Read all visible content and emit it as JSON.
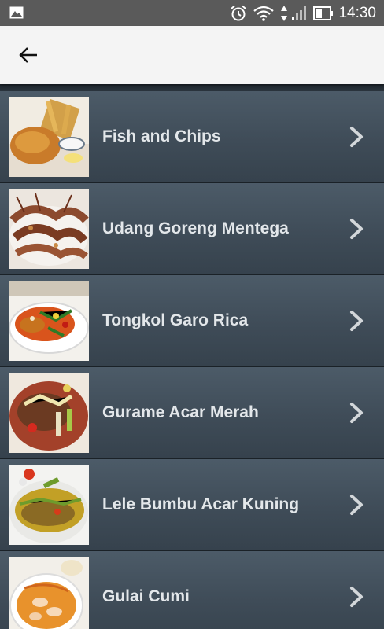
{
  "status_bar": {
    "time": "14:30",
    "icons": [
      "gallery-icon",
      "alarm-icon",
      "wifi-icon",
      "data-arrows-icon",
      "signal-icon",
      "battery-icon"
    ]
  },
  "app_bar": {
    "back_icon": "arrow-left-icon"
  },
  "items": [
    {
      "title": "Fish and Chips"
    },
    {
      "title": "Udang Goreng Mentega"
    },
    {
      "title": "Tongkol Garo Rica"
    },
    {
      "title": "Gurame Acar Merah"
    },
    {
      "title": "Lele Bumbu Acar Kuning"
    },
    {
      "title": "Gulai Cumi"
    }
  ],
  "colors": {
    "status_bar": "#5a5a5a",
    "app_bar": "#f4f4f4",
    "row_bg": "#45525e",
    "row_text": "#e3e7ea"
  }
}
